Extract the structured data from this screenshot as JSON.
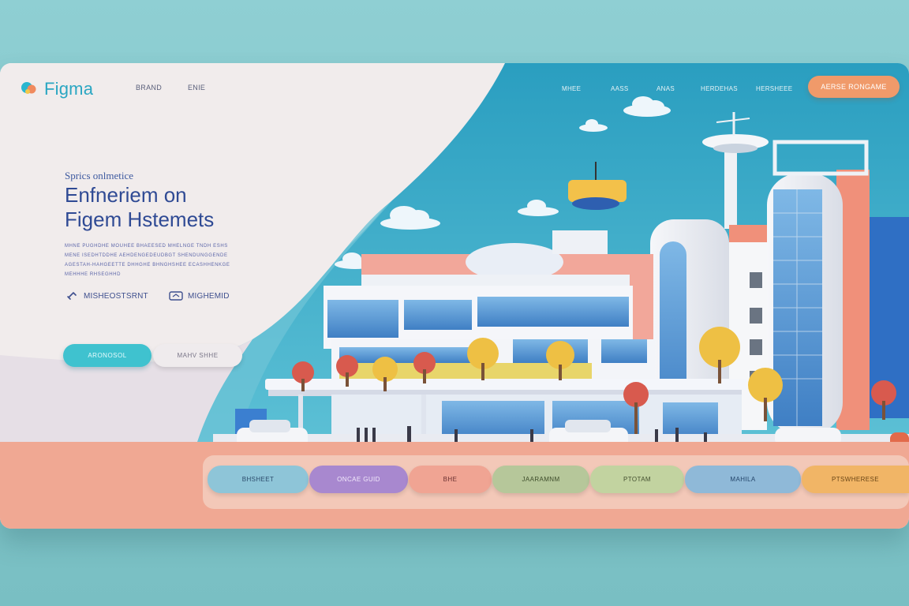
{
  "brand": {
    "logo_text": "Figma"
  },
  "nav": {
    "left": [
      "BRAND",
      "ENIE"
    ],
    "right": [
      "MHEE",
      "AASS",
      "ANAS",
      "HERDEHAS",
      "HERSHEEE"
    ],
    "cta": "AERSE RONGAME"
  },
  "hero": {
    "eyebrow": "Sprics onlmetice",
    "headline_line1": "Enfneriem on",
    "headline_line2": "Figem Hstemets",
    "body_lines": [
      "MHNE PUGHDHE MOUHEE BHAEESED MHELNGE TNDH ESHS",
      "MENE ISEDHTDDHE AEHDENGEDEUDBGT SHENDUNGGENDE",
      "AGESTAH-HAHGEETTE DHHGHE BHNGHSHEE ECASHHENKGE",
      "MEHHHE RHSEGHHD"
    ],
    "feature_1": "MISHEOSTSRNT",
    "feature_2": "MIGHEMID",
    "primary_button": "ARONOSOL",
    "secondary_button": "MAHV SHHE"
  },
  "categories": [
    "BHSHEET",
    "ONCAE GUID",
    "BHE",
    "JAARAMNM",
    "PTOTAM",
    "MAHILA",
    "PTSWHERESE"
  ],
  "colors": {
    "accent_teal": "#3fc2cf",
    "accent_orange": "#f09a6a",
    "headline_blue": "#2f4a94",
    "sky_blue": "#2fa8c6"
  },
  "icons": [
    "figma-logo-icon",
    "link-icon",
    "home-card-icon",
    "cloud-icon"
  ]
}
